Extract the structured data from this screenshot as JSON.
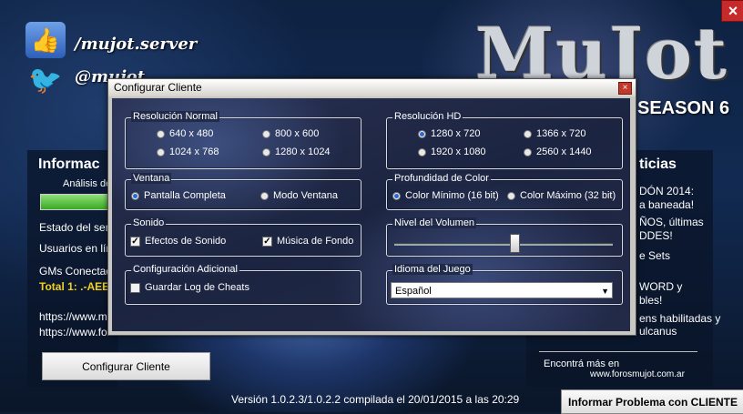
{
  "app": {
    "facebook_handle": "/mujot.server",
    "twitter_handle": "@mujot",
    "logo_text": "MuJot",
    "logo_season": "SEASON 6",
    "close_label": "×"
  },
  "left": {
    "title": "Informac",
    "analysis_label": "Análisis de",
    "status_label": "Estado del serv",
    "users_label": "Usuarios en lín",
    "gms_label": "GMs Conectad",
    "total_label": "Total 1: .-AEES-",
    "link1": "https://www.mu",
    "link2": "https://www.for",
    "config_button": "Configurar Cliente"
  },
  "right": {
    "title": "ticias",
    "lines": [
      "DÓN 2014:",
      "a baneada!",
      "ÑOS, últimas",
      "DDES!",
      "e Sets",
      "WORD y",
      "bles!",
      "ens habilitadas y",
      "ulcanus"
    ],
    "footer_text": "Encontrá  más  en",
    "footer_link": "www.forosmujot.com.ar"
  },
  "footer": {
    "version": "Versión 1.0.2.3/1.0.2.2 compilada el 20/01/2015 a las 20:29",
    "report_button": "Informar Problema con CLIENTE"
  },
  "dialog": {
    "title": "Configurar Cliente",
    "close": "×",
    "res_normal": {
      "label": "Resolución Normal",
      "options": [
        "640 x 480",
        "800 x 600",
        "1024 x 768",
        "1280 x 1024"
      ]
    },
    "res_hd": {
      "label": "Resolución HD",
      "options": [
        "1280 x 720",
        "1366 x 720",
        "1920 x 1080",
        "2560 x 1440"
      ],
      "selected": "1280 x 720"
    },
    "ventana": {
      "label": "Ventana",
      "options": [
        "Pantalla Completa",
        "Modo Ventana"
      ],
      "selected": "Pantalla Completa"
    },
    "color": {
      "label": "Profundidad de Color",
      "options": [
        "Color Mínimo (16 bit)",
        "Color Máximo (32 bit)"
      ],
      "selected": "Color Mínimo (16 bit)"
    },
    "sonido": {
      "label": "Sonido",
      "effects": "Efectos de Sonido",
      "effects_checked": true,
      "music": "Música de Fondo",
      "music_checked": true
    },
    "volume": {
      "label": "Nivel del Volumen",
      "value_percent": 55
    },
    "extra": {
      "label": "Configuración Adicional",
      "log_cheats": "Guardar Log de Cheats",
      "log_checked": false
    },
    "language": {
      "label": "Idioma del Juego",
      "selected": "Español"
    }
  }
}
